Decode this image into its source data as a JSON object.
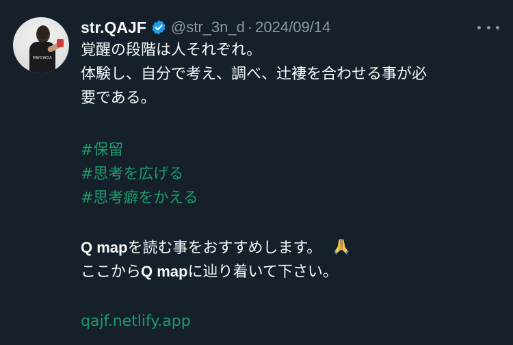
{
  "tweet": {
    "display_name": "str.QAJF",
    "handle": "@str_3n_d",
    "separator": "·",
    "date": "2024/09/14",
    "avatar_shirt_text": "MWGWGA",
    "lines": {
      "line1": "覚醒の段階は人それぞれ。",
      "line2": "体験し、自分で考え、調べ、辻褄を合わせる事が必",
      "line3": "要である。",
      "hashtag1": "#保留",
      "hashtag2": "#思考を広げる",
      "hashtag3": "#思考癖をかえる",
      "line7_bold": "Q map",
      "line7_rest": "を読む事をおすすめします。",
      "line7_emoji": "folded-hands",
      "line8_pre": "ここから",
      "line8_bold": "Q map",
      "line8_post": "に辿り着いて下さい。",
      "link": "qajf.netlify.app"
    }
  },
  "colors": {
    "background": "#15202b",
    "text": "#f7f9f9",
    "secondary": "#8b98a5",
    "hashtag": "#1d9a6c",
    "verified": "#1d9bf0"
  },
  "icons": {
    "verified": "verified-badge-icon",
    "more": "more-dots-icon",
    "emoji": "folded-hands-emoji-icon"
  }
}
